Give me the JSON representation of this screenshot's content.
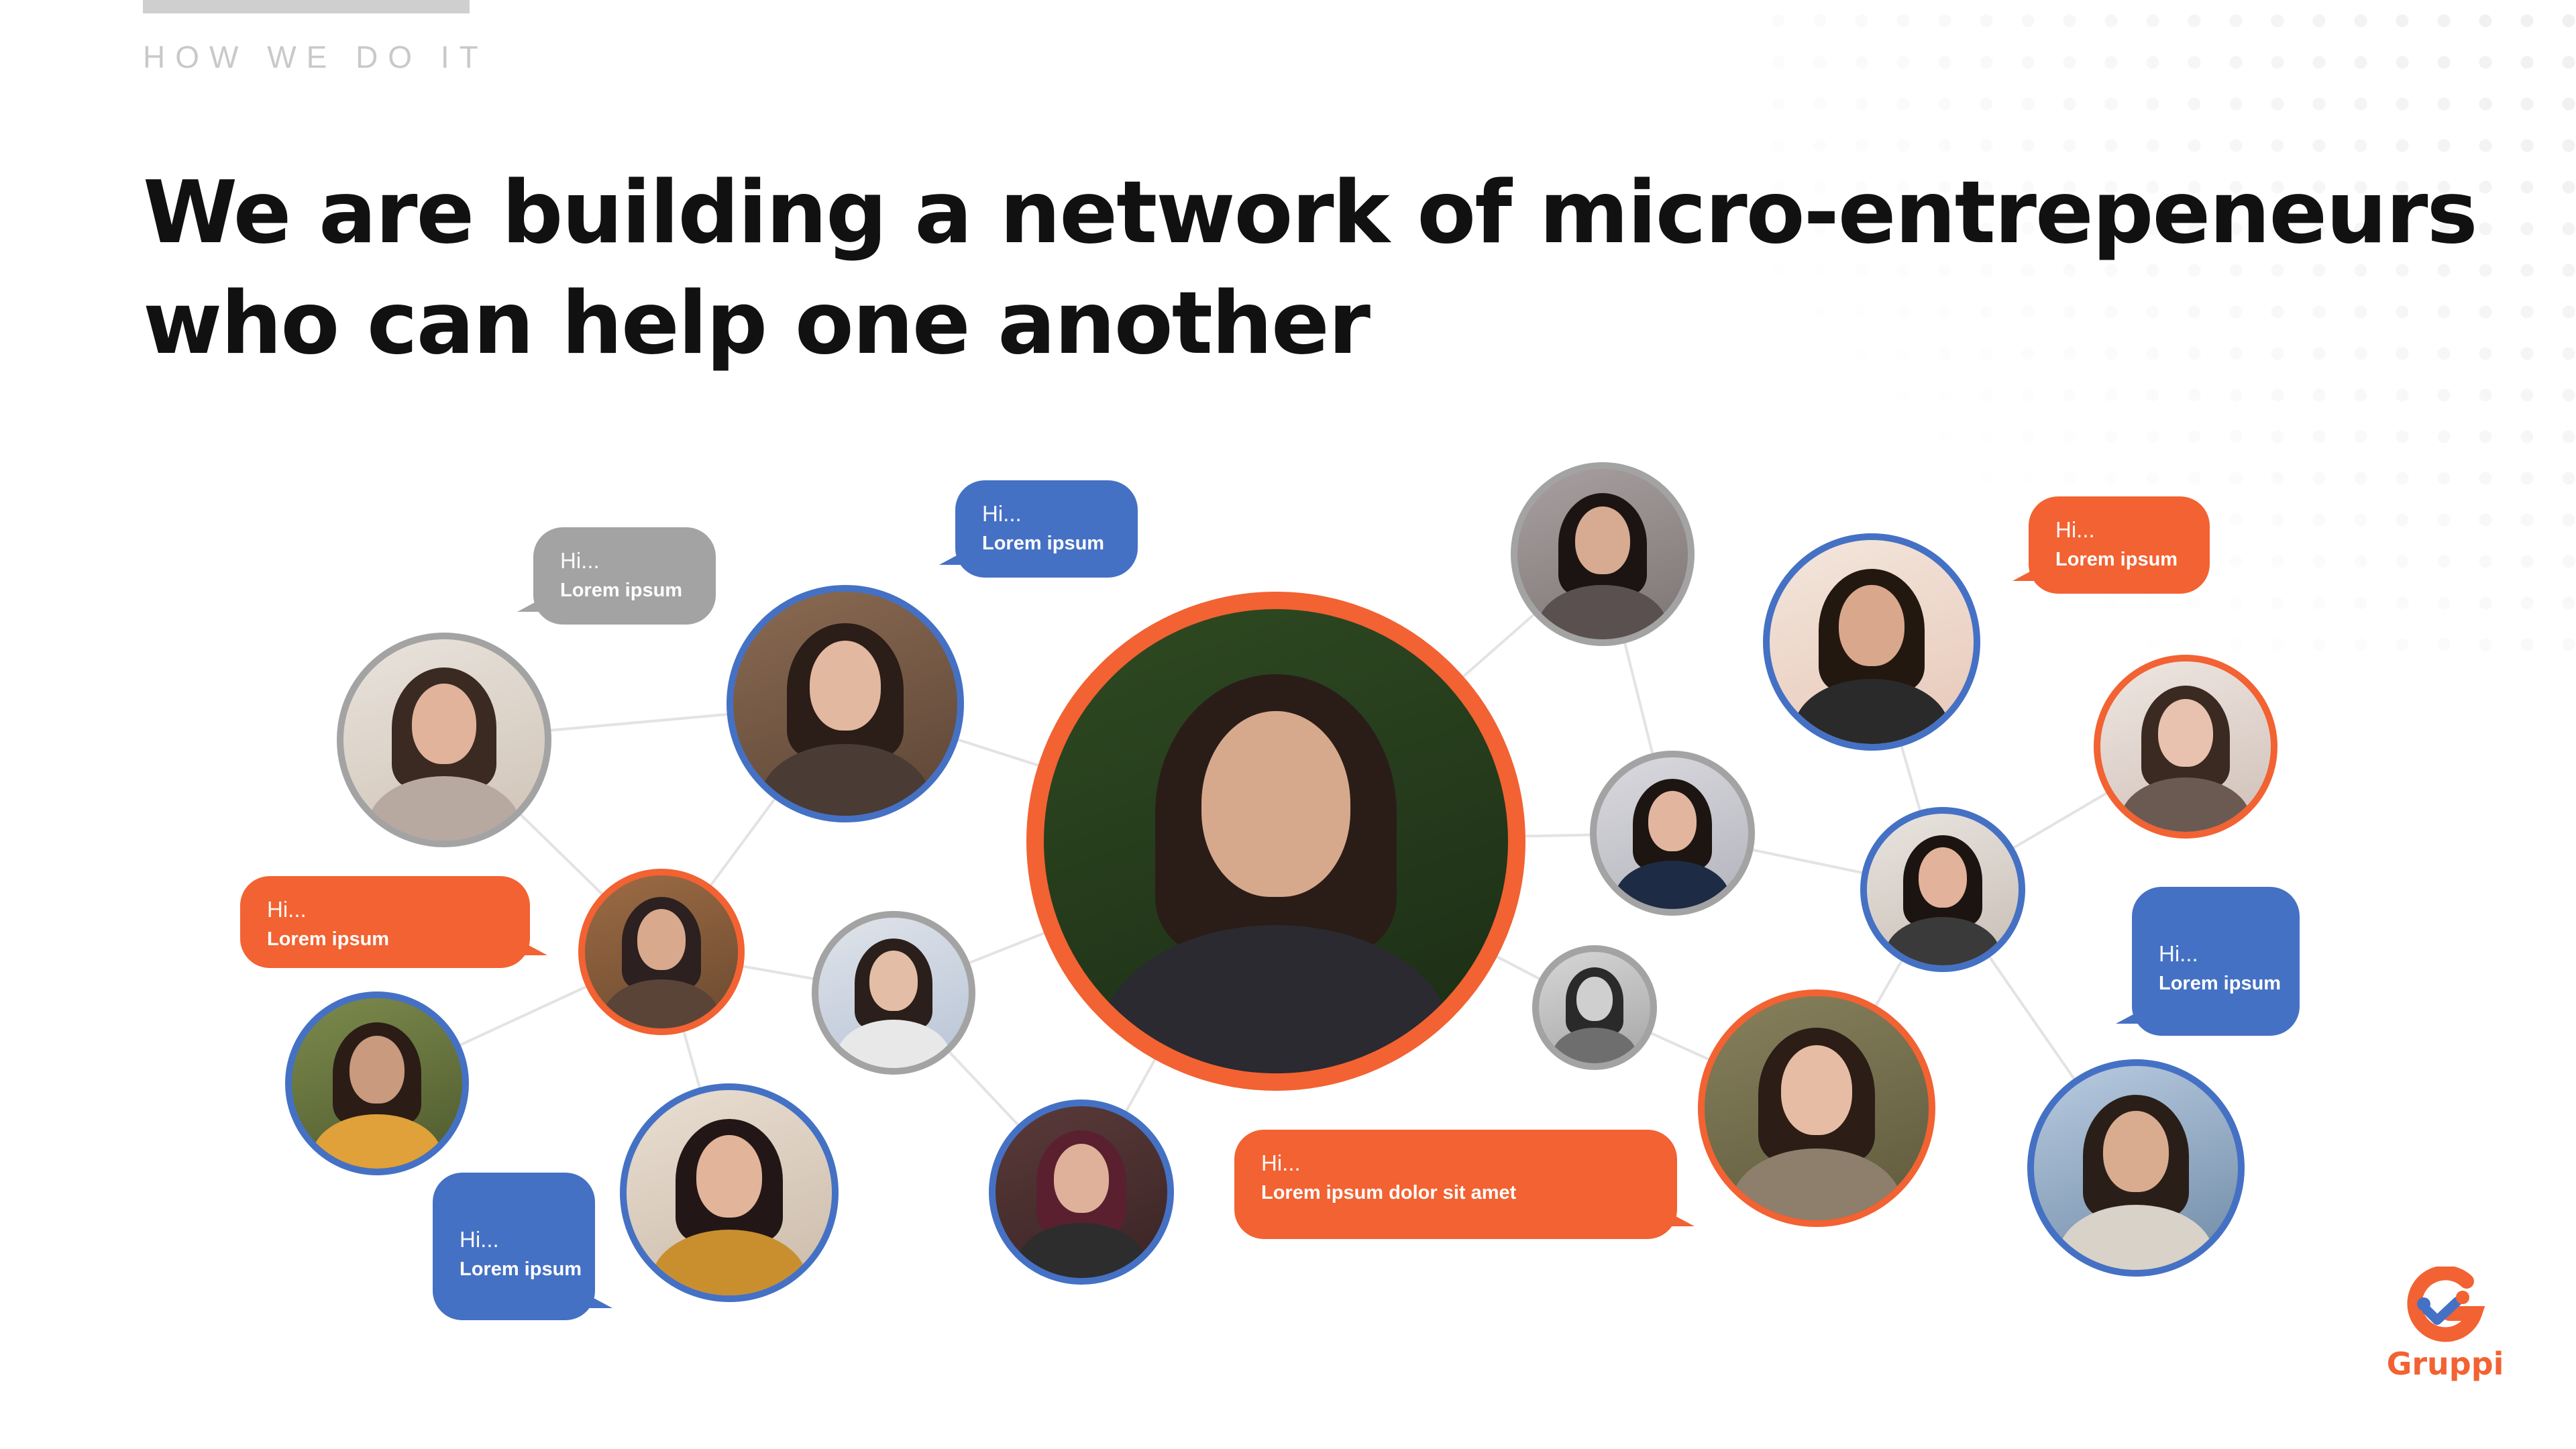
{
  "header": {
    "eyebrow": "HOW WE DO IT",
    "title_line_1": "We are building a network of micro-entrepeneurs",
    "title_line_2": "who can help one another"
  },
  "colors": {
    "orange": "#f26232",
    "blue": "#4571c4",
    "gray": "#a3a3a3",
    "dark_text": "#111111",
    "eyebrow_text": "#c9c9c9",
    "connector": "#e3e3e3"
  },
  "network": {
    "bubbles": [
      {
        "name": "bubble-gray-1",
        "color": "gray",
        "hi": "Hi...",
        "text": "Lorem ipsum"
      },
      {
        "name": "bubble-blue-1",
        "color": "blue",
        "hi": "Hi...",
        "text": "Lorem ipsum"
      },
      {
        "name": "bubble-orange-1",
        "color": "orange",
        "hi": "Hi...",
        "text": "Lorem ipsum"
      },
      {
        "name": "bubble-blue-2",
        "color": "blue",
        "hi": "Hi...",
        "text": "Lorem ipsum"
      },
      {
        "name": "bubble-orange-center",
        "color": "orange",
        "hi": "Hi...",
        "text": "Lorem ipsum dolor sit amet"
      },
      {
        "name": "bubble-orange-2",
        "color": "orange",
        "hi": "Hi...",
        "text": "Lorem ipsum"
      },
      {
        "name": "bubble-blue-3",
        "color": "blue",
        "hi": "Hi...",
        "text": "Lorem ipsum"
      }
    ],
    "profiles": [
      {
        "name": "profile-photo-center",
        "ring": "orange"
      },
      {
        "name": "profile-photo-1",
        "ring": "gray"
      },
      {
        "name": "profile-photo-2",
        "ring": "blue"
      },
      {
        "name": "profile-photo-3",
        "ring": "orange"
      },
      {
        "name": "profile-photo-4",
        "ring": "gray"
      },
      {
        "name": "profile-photo-5",
        "ring": "blue"
      },
      {
        "name": "profile-photo-6",
        "ring": "blue"
      },
      {
        "name": "profile-photo-7",
        "ring": "blue"
      },
      {
        "name": "profile-photo-8",
        "ring": "gray"
      },
      {
        "name": "profile-photo-9",
        "ring": "gray"
      },
      {
        "name": "profile-photo-10",
        "ring": "blue"
      },
      {
        "name": "profile-photo-11",
        "ring": "orange"
      },
      {
        "name": "profile-photo-12",
        "ring": "blue"
      },
      {
        "name": "profile-photo-13",
        "ring": "orange"
      },
      {
        "name": "profile-photo-14",
        "ring": "gray"
      },
      {
        "name": "profile-photo-15",
        "ring": "orange"
      },
      {
        "name": "profile-photo-16",
        "ring": "blue"
      }
    ]
  },
  "logo": {
    "text": "Gruppi",
    "icon": "gruppi-logo-icon"
  }
}
